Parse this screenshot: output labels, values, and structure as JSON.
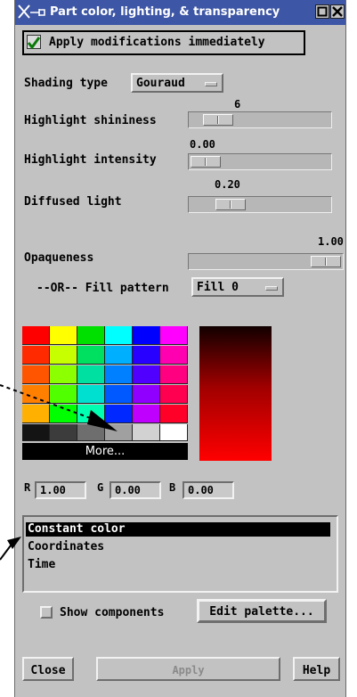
{
  "window": {
    "title": "Part color, lighting, & transparency"
  },
  "apply_immediately": {
    "label": "Apply modifications immediately",
    "checked": true
  },
  "shading": {
    "label": "Shading type",
    "value": "Gouraud"
  },
  "sliders": {
    "highlight_shininess": {
      "label": "Highlight shininess",
      "value": "6",
      "level": 0.1
    },
    "highlight_intensity": {
      "label": "Highlight intensity",
      "value": "0.00",
      "level": 0.0
    },
    "diffused_light": {
      "label": "Diffused light",
      "value": "0.20",
      "level": 0.2
    },
    "opaqueness": {
      "label": "Opaqueness",
      "value": "1.00",
      "level": 1.0
    }
  },
  "fill_pattern": {
    "label": "--OR-- Fill pattern",
    "value": "Fill 0"
  },
  "palette": {
    "colors": [
      [
        "#ff0000",
        "#ffff00",
        "#00e000",
        "#00ffff",
        "#0000ff",
        "#ff00ff"
      ],
      [
        "#ff2a00",
        "#c8ff00",
        "#00e060",
        "#00b0ff",
        "#2800ff",
        "#ff00b0"
      ],
      [
        "#ff5500",
        "#8cff00",
        "#00e0a0",
        "#0080ff",
        "#5000ff",
        "#ff0080"
      ],
      [
        "#ff8000",
        "#50ff00",
        "#00e0d0",
        "#0058ff",
        "#9000ff",
        "#ff0050"
      ],
      [
        "#ffb000",
        "#00ff00",
        "#00ffb0",
        "#0028ff",
        "#c000ff",
        "#ff0028"
      ],
      [
        "#141414",
        "#3c3c3c",
        "#6e6e6e",
        "#a0a0a0",
        "#d2d2d2",
        "#ffffff"
      ]
    ],
    "more_label": "More..."
  },
  "rgb": {
    "r_label": "R",
    "r_value": "1.00",
    "g_label": "G",
    "g_value": "0.00",
    "b_label": "B",
    "b_value": "0.00"
  },
  "color_mode_list": {
    "items": [
      "Constant color",
      "Coordinates",
      "Time"
    ],
    "selected": "Constant color"
  },
  "show_components": {
    "label": "Show components",
    "checked": false
  },
  "buttons": {
    "edit_palette": "Edit palette...",
    "close": "Close",
    "apply": "Apply",
    "help": "Help"
  },
  "colors": {
    "titlebar": "#3d56a5",
    "panel": "#c2c2c2",
    "selection": "#000000",
    "checkmark": "#0a7a0a"
  }
}
